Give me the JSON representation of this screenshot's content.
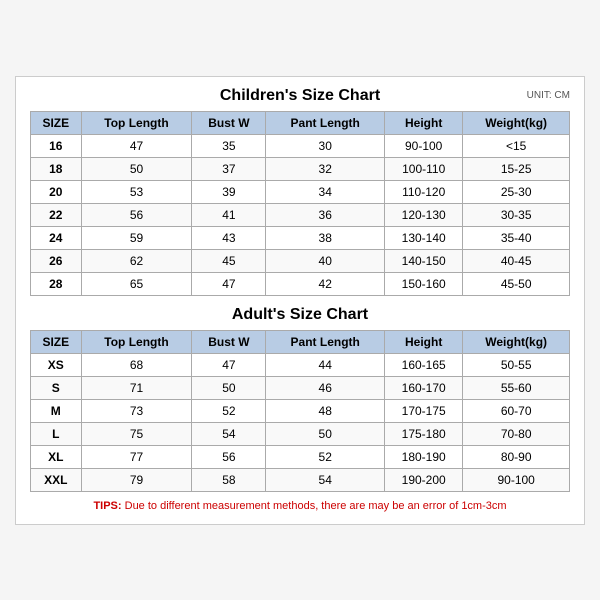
{
  "children": {
    "title": "Children's Size Chart",
    "unit": "UNIT: CM",
    "headers": [
      "SIZE",
      "Top Length",
      "Bust W",
      "Pant Length",
      "Height",
      "Weight(kg)"
    ],
    "rows": [
      [
        "16",
        "47",
        "35",
        "30",
        "90-100",
        "<15"
      ],
      [
        "18",
        "50",
        "37",
        "32",
        "100-110",
        "15-25"
      ],
      [
        "20",
        "53",
        "39",
        "34",
        "110-120",
        "25-30"
      ],
      [
        "22",
        "56",
        "41",
        "36",
        "120-130",
        "30-35"
      ],
      [
        "24",
        "59",
        "43",
        "38",
        "130-140",
        "35-40"
      ],
      [
        "26",
        "62",
        "45",
        "40",
        "140-150",
        "40-45"
      ],
      [
        "28",
        "65",
        "47",
        "42",
        "150-160",
        "45-50"
      ]
    ]
  },
  "adults": {
    "title": "Adult's Size Chart",
    "headers": [
      "SIZE",
      "Top Length",
      "Bust W",
      "Pant Length",
      "Height",
      "Weight(kg)"
    ],
    "rows": [
      [
        "XS",
        "68",
        "47",
        "44",
        "160-165",
        "50-55"
      ],
      [
        "S",
        "71",
        "50",
        "46",
        "160-170",
        "55-60"
      ],
      [
        "M",
        "73",
        "52",
        "48",
        "170-175",
        "60-70"
      ],
      [
        "L",
        "75",
        "54",
        "50",
        "175-180",
        "70-80"
      ],
      [
        "XL",
        "77",
        "56",
        "52",
        "180-190",
        "80-90"
      ],
      [
        "XXL",
        "79",
        "58",
        "54",
        "190-200",
        "90-100"
      ]
    ]
  },
  "tips": {
    "label": "TIPS:",
    "text": " Due to different measurement methods, there are may be an error of 1cm-3cm"
  }
}
